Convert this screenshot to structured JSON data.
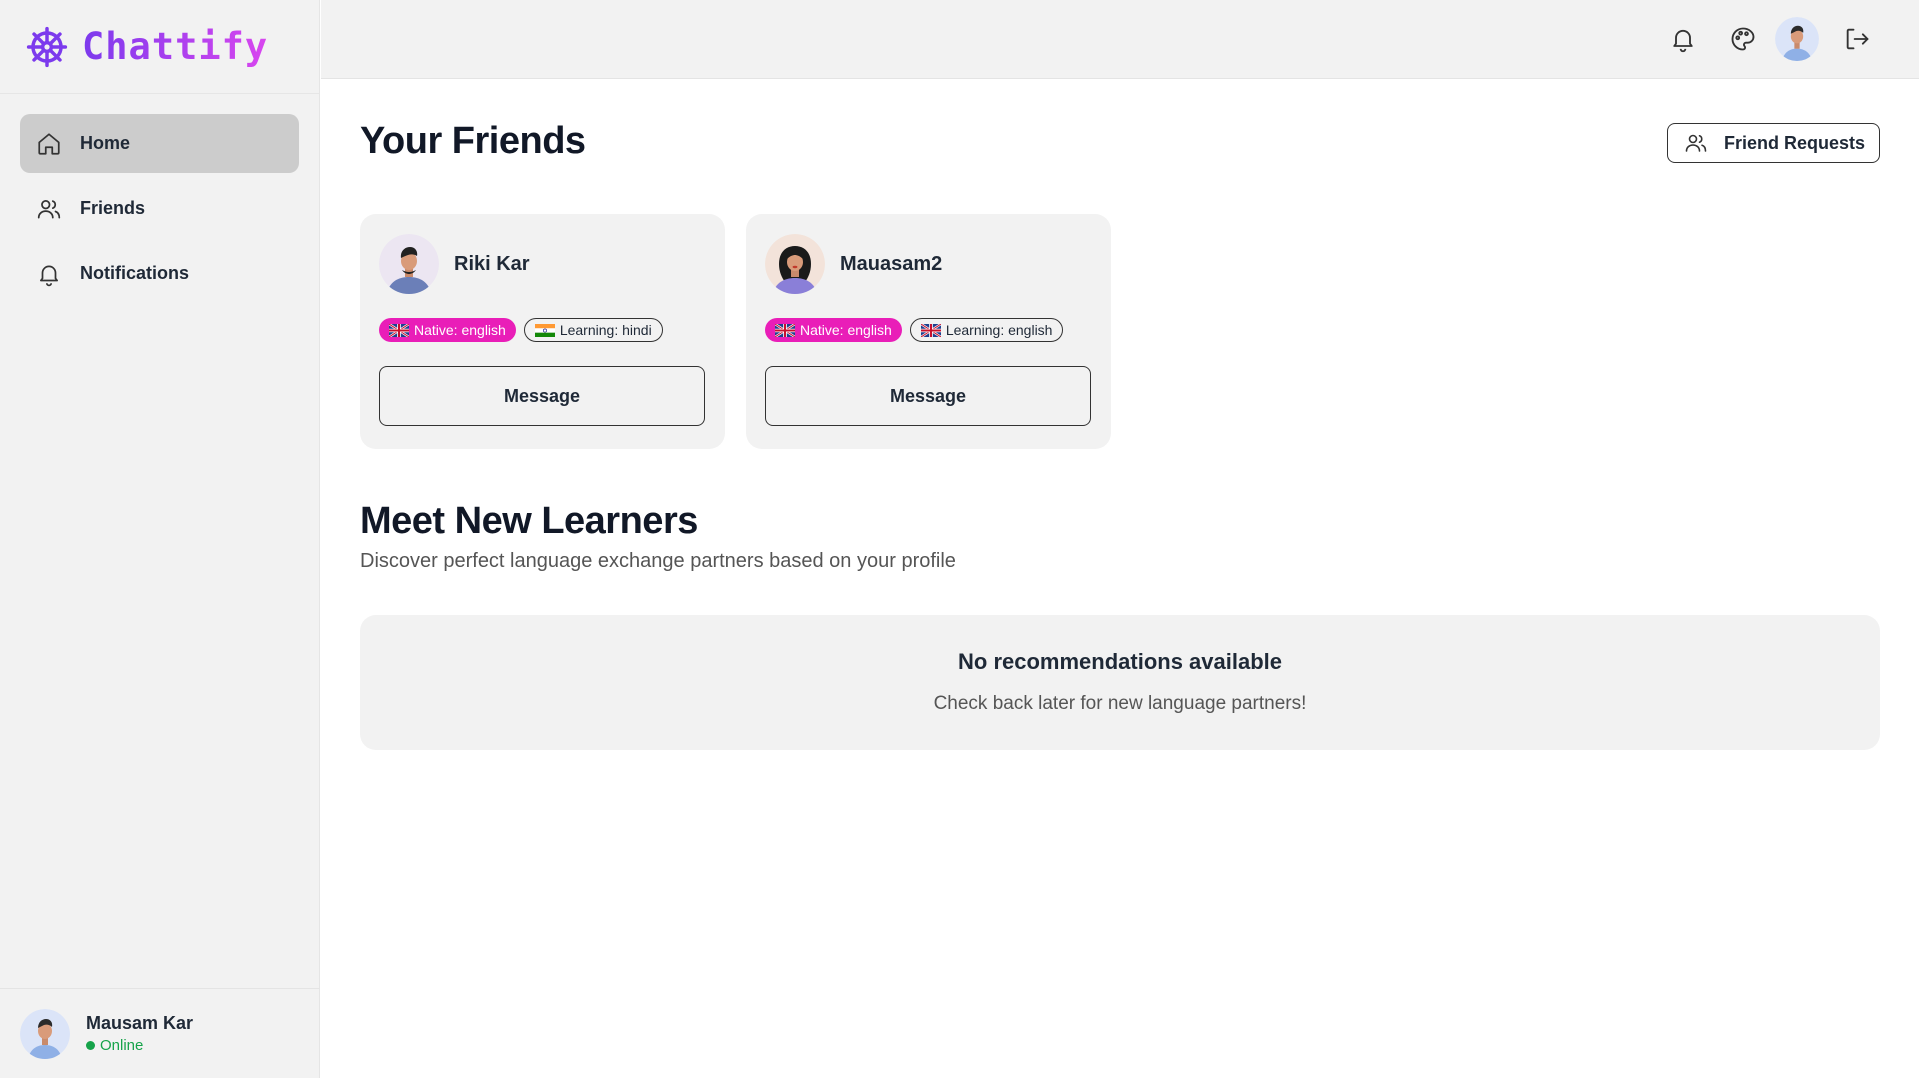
{
  "brand": {
    "name": "Chattify",
    "icon": "ship-wheel-icon",
    "accent": "#7c3aed",
    "accent2": "#d946ef"
  },
  "sidebar": {
    "items": [
      {
        "label": "Home",
        "icon": "home-icon",
        "active": true
      },
      {
        "label": "Friends",
        "icon": "users-icon",
        "active": false
      },
      {
        "label": "Notifications",
        "icon": "bell-icon",
        "active": false
      }
    ],
    "user": {
      "name": "Mausam Kar",
      "status": "Online"
    }
  },
  "topbar": {
    "icons": [
      "bell-icon",
      "palette-icon",
      "avatar",
      "logout-icon"
    ]
  },
  "friends_section": {
    "title": "Your Friends",
    "requests_button": "Friend Requests",
    "friends": [
      {
        "name": "Riki Kar",
        "native": "Native: english",
        "learning": "Learning: hindi",
        "native_flag": "uk-flag",
        "learning_flag": "india-flag",
        "button": "Message"
      },
      {
        "name": "Mauasam2",
        "native": "Native: english",
        "learning": "Learning: english",
        "native_flag": "uk-flag",
        "learning_flag": "uk-flag",
        "button": "Message"
      }
    ]
  },
  "learners_section": {
    "title": "Meet New Learners",
    "subtitle": "Discover perfect language exchange partners based on your profile",
    "empty_title": "No recommendations available",
    "empty_subtitle": "Check back later for new language partners!"
  },
  "colors": {
    "native_badge": "#e91eb8",
    "online": "#16a34a"
  }
}
